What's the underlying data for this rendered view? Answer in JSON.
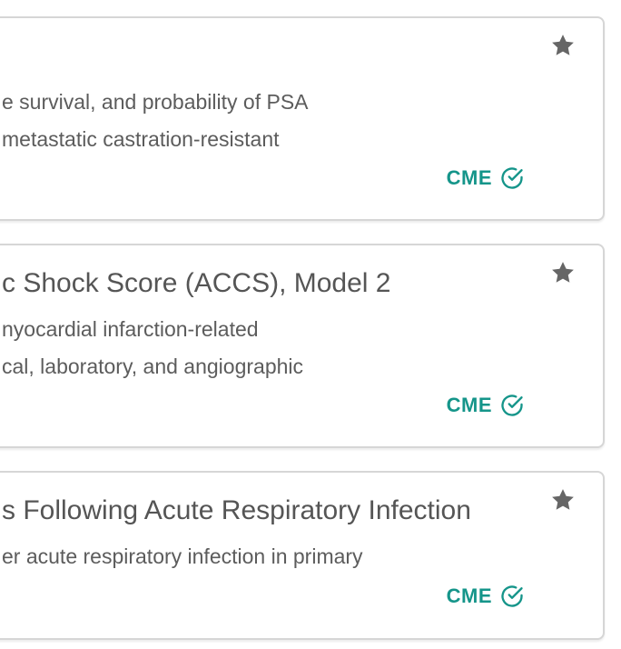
{
  "colors": {
    "accent": "#15958a",
    "star": "#666666",
    "text": "#555555",
    "border": "#d6d6d6"
  },
  "cards": [
    {
      "title": "",
      "description": "e survival, and probability of PSA\n metastatic castration-resistant",
      "badge": "CME",
      "badge_icon": "check-circle-icon",
      "favorite_icon": "star-icon"
    },
    {
      "title": "c Shock Score (ACCS), Model 2",
      "description": "nyocardial infarction-related\ncal, laboratory, and angiographic",
      "badge": "CME",
      "badge_icon": "check-circle-icon",
      "favorite_icon": "star-icon"
    },
    {
      "title": "s Following Acute Respiratory Infection",
      "description": "er acute respiratory infection in primary",
      "badge": "CME",
      "badge_icon": "check-circle-icon",
      "favorite_icon": "star-icon"
    }
  ]
}
